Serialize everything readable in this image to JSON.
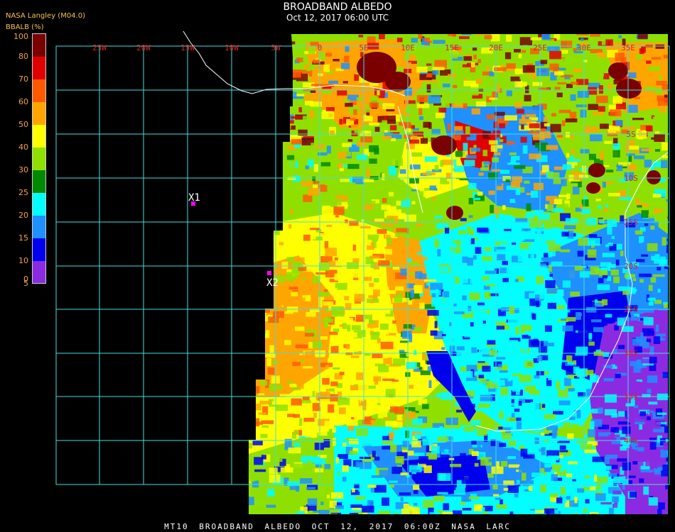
{
  "header": {
    "title": "BROADBAND ALBEDO",
    "subtitle": "Oct 12, 2017 06:00 UTC",
    "source": "NASA Langley (M04.0)"
  },
  "colorbar": {
    "label": "BBALB (%)",
    "ticks": [
      "100",
      "80",
      "70",
      "60",
      "50",
      "40",
      "30",
      "25",
      "20",
      "15",
      "10",
      "5",
      "0"
    ],
    "colors": [
      "#7a0000",
      "#e00000",
      "#ff5a00",
      "#ffa500",
      "#ffff00",
      "#8fe000",
      "#008a00",
      "#00ffff",
      "#1e90ff",
      "#0000ee",
      "#8a2be2"
    ]
  },
  "map": {
    "lon_labels": [
      "25W",
      "20W",
      "15W",
      "10W",
      "5W",
      "0",
      "5E",
      "10E",
      "15E",
      "20E",
      "25E",
      "30E",
      "35E"
    ],
    "lat_labels": [
      "5S",
      "10S",
      "15S",
      "20S",
      "25S",
      "30S",
      "35S",
      "40S"
    ],
    "grid_color": "#40e0e0",
    "label_color": "#e02020",
    "markers": [
      {
        "label": "X1",
        "color": "#ff00ff"
      },
      {
        "label": "X2",
        "color": "#ff00ff"
      }
    ]
  },
  "footer": "MT10 BROADBAND ALBEDO OCT 12, 2017 06:00Z NASA LARC"
}
